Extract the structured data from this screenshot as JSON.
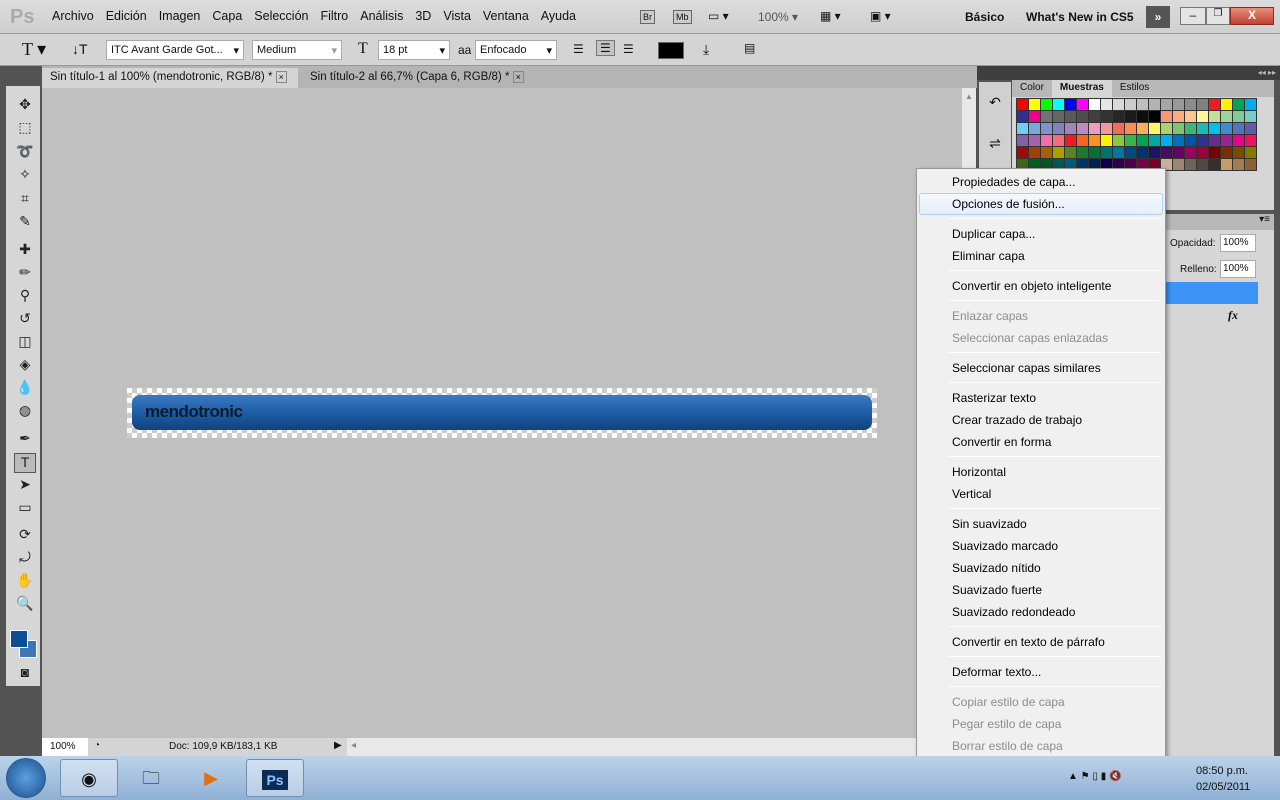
{
  "app": {
    "logo": "Ps"
  },
  "menu": [
    "Archivo",
    "Edición",
    "Imagen",
    "Capa",
    "Selección",
    "Filtro",
    "Análisis",
    "3D",
    "Vista",
    "Ventana",
    "Ayuda"
  ],
  "appbar": {
    "bridge": "Br",
    "minibridge": "Mb",
    "zoom": "100%",
    "workspace_basic": "Básico",
    "workspace_new": "What's New in CS5"
  },
  "options": {
    "font_family": "ITC Avant Garde Got...",
    "font_style": "Medium",
    "font_size": "18 pt",
    "antialias": "Enfocado",
    "text_color": "#000000"
  },
  "tabs": [
    {
      "label": "Sin título-1 al 100% (mendotronic, RGB/8) *",
      "active": true
    },
    {
      "label": "Sin título-2 al 66,7% (Capa 6, RGB/8) *",
      "active": false
    }
  ],
  "canvas": {
    "text": "mendotronic",
    "bar_color": "#1d5ea8"
  },
  "status": {
    "zoom": "100%",
    "doc": "Doc: 109,9 KB/183,1 KB"
  },
  "panel_tabs": [
    "Color",
    "Muestras",
    "Estilos"
  ],
  "swatches": [
    "#ff0000",
    "#ffff00",
    "#00ff00",
    "#00ffff",
    "#0000ff",
    "#ff00ff",
    "#ffffff",
    "#e6e6e6",
    "#d9d9d9",
    "#cccccc",
    "#bfbfbf",
    "#b3b3b3",
    "#a6a6a6",
    "#999999",
    "#8c8c8c",
    "#808080",
    "#ed1c24",
    "#fff200",
    "#00a651",
    "#00aeef",
    "#2e3192",
    "#ec008c",
    "#737373",
    "#666666",
    "#595959",
    "#4d4d4d",
    "#404040",
    "#333333",
    "#262626",
    "#1a1a1a",
    "#0d0d0d",
    "#000000",
    "#f7977a",
    "#fbad82",
    "#fdc68c",
    "#fff799",
    "#c4df9b",
    "#a3d39c",
    "#82ca9c",
    "#7accc8",
    "#6dcff6",
    "#7da7d9",
    "#8393ca",
    "#8781bd",
    "#a186be",
    "#bd8cbf",
    "#f49ac1",
    "#f5989d",
    "#f26c4f",
    "#f68e56",
    "#fbaf5d",
    "#fff568",
    "#acd372",
    "#7cc576",
    "#3bb878",
    "#1abbb4",
    "#00bff3",
    "#438ccb",
    "#5574b9",
    "#605ca8",
    "#855fa8",
    "#a763a8",
    "#f06ea9",
    "#f26d7d",
    "#ed1c24",
    "#f26522",
    "#f7941d",
    "#fff200",
    "#8dc73f",
    "#39b54a",
    "#00a651",
    "#00a99d",
    "#00aeef",
    "#0072bc",
    "#0054a6",
    "#2e3192",
    "#662d91",
    "#92278f",
    "#ec008c",
    "#ed145b",
    "#9e0b0f",
    "#a0410d",
    "#a36209",
    "#aba000",
    "#598527",
    "#197b30",
    "#007236",
    "#00746b",
    "#0076a3",
    "#004a80",
    "#003471",
    "#1b1464",
    "#440e62",
    "#630460",
    "#9e005d",
    "#9e0039",
    "#790000",
    "#7b2e00",
    "#7d4900",
    "#827b00",
    "#406618",
    "#005e20",
    "#005826",
    "#005952",
    "#005b7f",
    "#003663",
    "#002157",
    "#0d004c",
    "#32004b",
    "#4b0049",
    "#7b0046",
    "#7a0026",
    "#c7b299",
    "#998675",
    "#736357",
    "#534741",
    "#37302a",
    "#c69c6d",
    "#a67c52",
    "#8c6239"
  ],
  "layers": {
    "opacity_label": "Opacidad:",
    "opacity": "100%",
    "fill_label": "Relleno:",
    "fill": "100%",
    "fx": "fx"
  },
  "context_menu": [
    {
      "label": "Propiedades de capa..."
    },
    {
      "label": "Opciones de fusión...",
      "highlight": true
    },
    {
      "sep": true
    },
    {
      "label": "Duplicar capa..."
    },
    {
      "label": "Eliminar capa"
    },
    {
      "sep": true
    },
    {
      "label": "Convertir en objeto inteligente"
    },
    {
      "sep": true
    },
    {
      "label": "Enlazar capas",
      "disabled": true
    },
    {
      "label": "Seleccionar capas enlazadas",
      "disabled": true
    },
    {
      "sep": true
    },
    {
      "label": "Seleccionar capas similares"
    },
    {
      "sep": true
    },
    {
      "label": "Rasterizar texto"
    },
    {
      "label": "Crear trazado de trabajo"
    },
    {
      "label": "Convertir en forma"
    },
    {
      "sep": true
    },
    {
      "label": "Horizontal"
    },
    {
      "label": "Vertical"
    },
    {
      "sep": true
    },
    {
      "label": "Sin suavizado"
    },
    {
      "label": "Suavizado marcado"
    },
    {
      "label": "Suavizado nítido"
    },
    {
      "label": "Suavizado fuerte"
    },
    {
      "label": "Suavizado redondeado"
    },
    {
      "sep": true
    },
    {
      "label": "Convertir en texto de párrafo"
    },
    {
      "sep": true
    },
    {
      "label": "Deformar texto..."
    },
    {
      "sep": true
    },
    {
      "label": "Copiar estilo de capa",
      "disabled": true
    },
    {
      "label": "Pegar estilo de capa",
      "disabled": true
    },
    {
      "label": "Borrar estilo de capa",
      "disabled": true
    }
  ],
  "tray": {
    "time": "08:50 p.m.",
    "date": "02/05/2011"
  },
  "colors": {
    "foreground": "#0b4f95",
    "background": "#3f76b8"
  }
}
